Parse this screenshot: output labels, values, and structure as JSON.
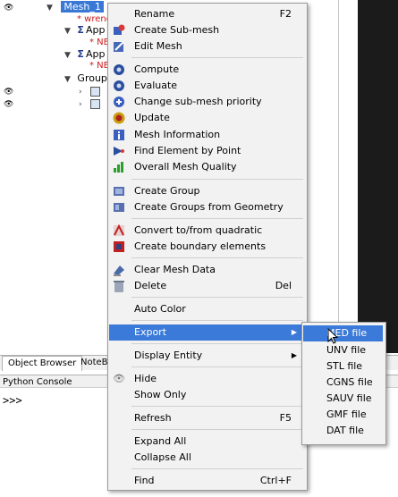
{
  "tree": {
    "mesh_label": "Mesh_1",
    "mesh_child_note": "* wrenc",
    "algo1_label": "App",
    "algo1_note": "* NE",
    "algo2_label": "App",
    "algo2_note": "* NE",
    "groups_label": "Groups"
  },
  "bottom_tabs": [
    "Object Browser",
    "NoteBo"
  ],
  "python_console": {
    "title": "Python Console",
    "prompt": ">>>"
  },
  "context_menu": {
    "rename": {
      "label": "Rename",
      "shortcut": "F2"
    },
    "create_sub_mesh": "Create Sub-mesh",
    "edit_mesh": "Edit Mesh",
    "compute": "Compute",
    "evaluate": "Evaluate",
    "change_priority": "Change sub-mesh priority",
    "update": "Update",
    "mesh_information": "Mesh Information",
    "find_element": "Find Element by Point",
    "overall_quality": "Overall Mesh Quality",
    "create_group": "Create Group",
    "create_groups_geom": "Create Groups from Geometry",
    "convert_quadratic": "Convert to/from quadratic",
    "create_boundary": "Create boundary elements",
    "clear_mesh_data": "Clear Mesh Data",
    "delete": {
      "label": "Delete",
      "shortcut": "Del"
    },
    "auto_color": "Auto Color",
    "export": "Export",
    "display_entity": "Display Entity",
    "hide": "Hide",
    "show_only": "Show Only",
    "refresh": {
      "label": "Refresh",
      "shortcut": "F5"
    },
    "expand_all": "Expand All",
    "collapse_all": "Collapse All",
    "find": {
      "label": "Find",
      "shortcut": "Ctrl+F"
    }
  },
  "export_submenu": [
    "MED file",
    "UNV file",
    "STL file",
    "CGNS file",
    "SAUV file",
    "GMF file",
    "DAT file"
  ],
  "colors": {
    "highlight": "#3b7ad8",
    "menu_bg": "#f2f2f2",
    "error_text": "#cc1a1a"
  }
}
